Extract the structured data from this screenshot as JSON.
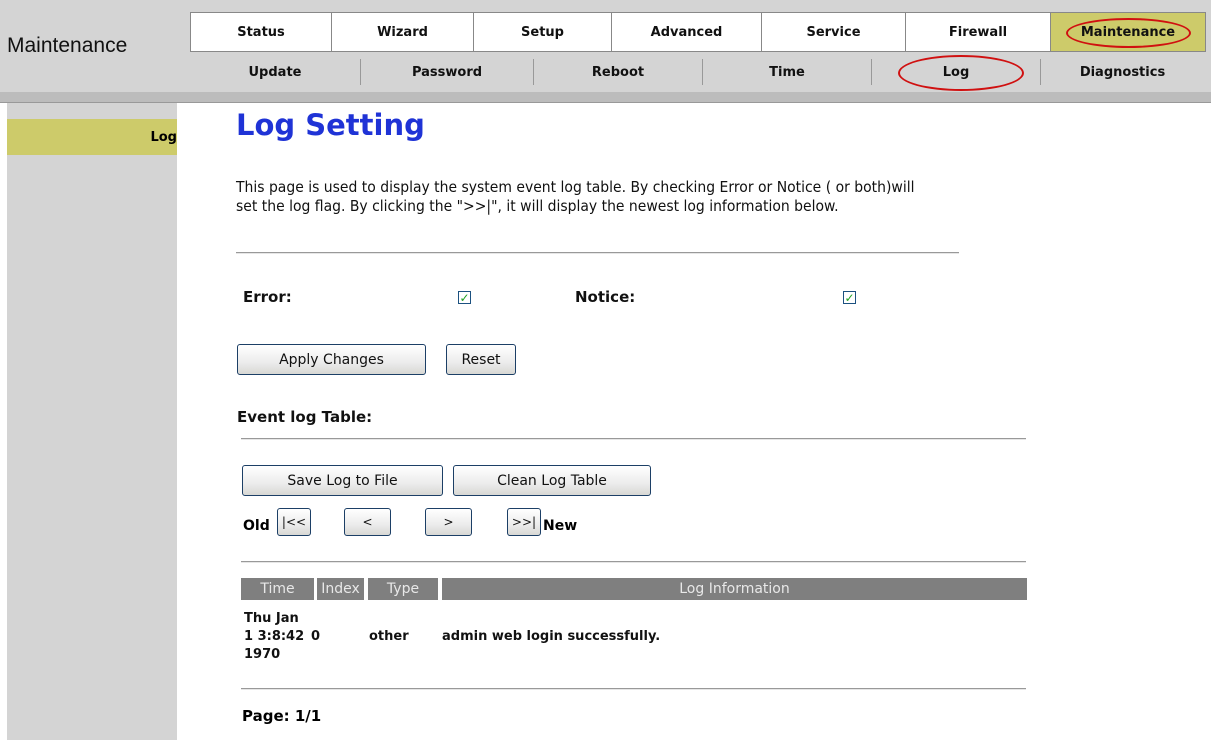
{
  "section": {
    "title": "Maintenance"
  },
  "main_tabs": [
    {
      "label": "Status"
    },
    {
      "label": "Wizard"
    },
    {
      "label": "Setup"
    },
    {
      "label": "Advanced"
    },
    {
      "label": "Service"
    },
    {
      "label": "Firewall"
    },
    {
      "label": "Maintenance",
      "active": true
    }
  ],
  "sub_tabs": [
    {
      "label": "Update"
    },
    {
      "label": "Password"
    },
    {
      "label": "Reboot"
    },
    {
      "label": "Time"
    },
    {
      "label": "Log",
      "active": true
    },
    {
      "label": "Diagnostics"
    }
  ],
  "sidebar": {
    "items": [
      {
        "label": "Log",
        "active": true
      }
    ]
  },
  "page": {
    "title": "Log Setting",
    "description": "This page is used to display the system event log table. By checking Error or Notice ( or both)will set the log flag. By clicking the \">>|\", it will display the newest log information below."
  },
  "flags": {
    "error_label": "Error:",
    "error_checked": true,
    "notice_label": "Notice:",
    "notice_checked": true
  },
  "buttons": {
    "apply": "Apply Changes",
    "reset": "Reset",
    "save_log": "Save Log to File",
    "clean_log": "Clean Log Table"
  },
  "event_log": {
    "heading": "Event log Table:",
    "old_label": "Old",
    "new_label": "New",
    "nav": {
      "first": "|<<",
      "prev": "<",
      "next": ">",
      "last": ">>|"
    },
    "columns": [
      "Time",
      "Index",
      "Type",
      "Log Information"
    ],
    "rows": [
      {
        "time": "Thu Jan 1 3:8:42 1970",
        "time_lines": [
          "Thu Jan",
          "1 3:8:42",
          "1970"
        ],
        "index": "0",
        "type": "other",
        "info": "admin web login successfully."
      }
    ],
    "page": "Page: 1/1"
  },
  "colors": {
    "active_tab": "#cdcb6a",
    "title_blue": "#1f33d6",
    "annotation_red": "#d01010",
    "panel_gray": "#d4d4d4",
    "table_header": "#7f7f7f"
  }
}
